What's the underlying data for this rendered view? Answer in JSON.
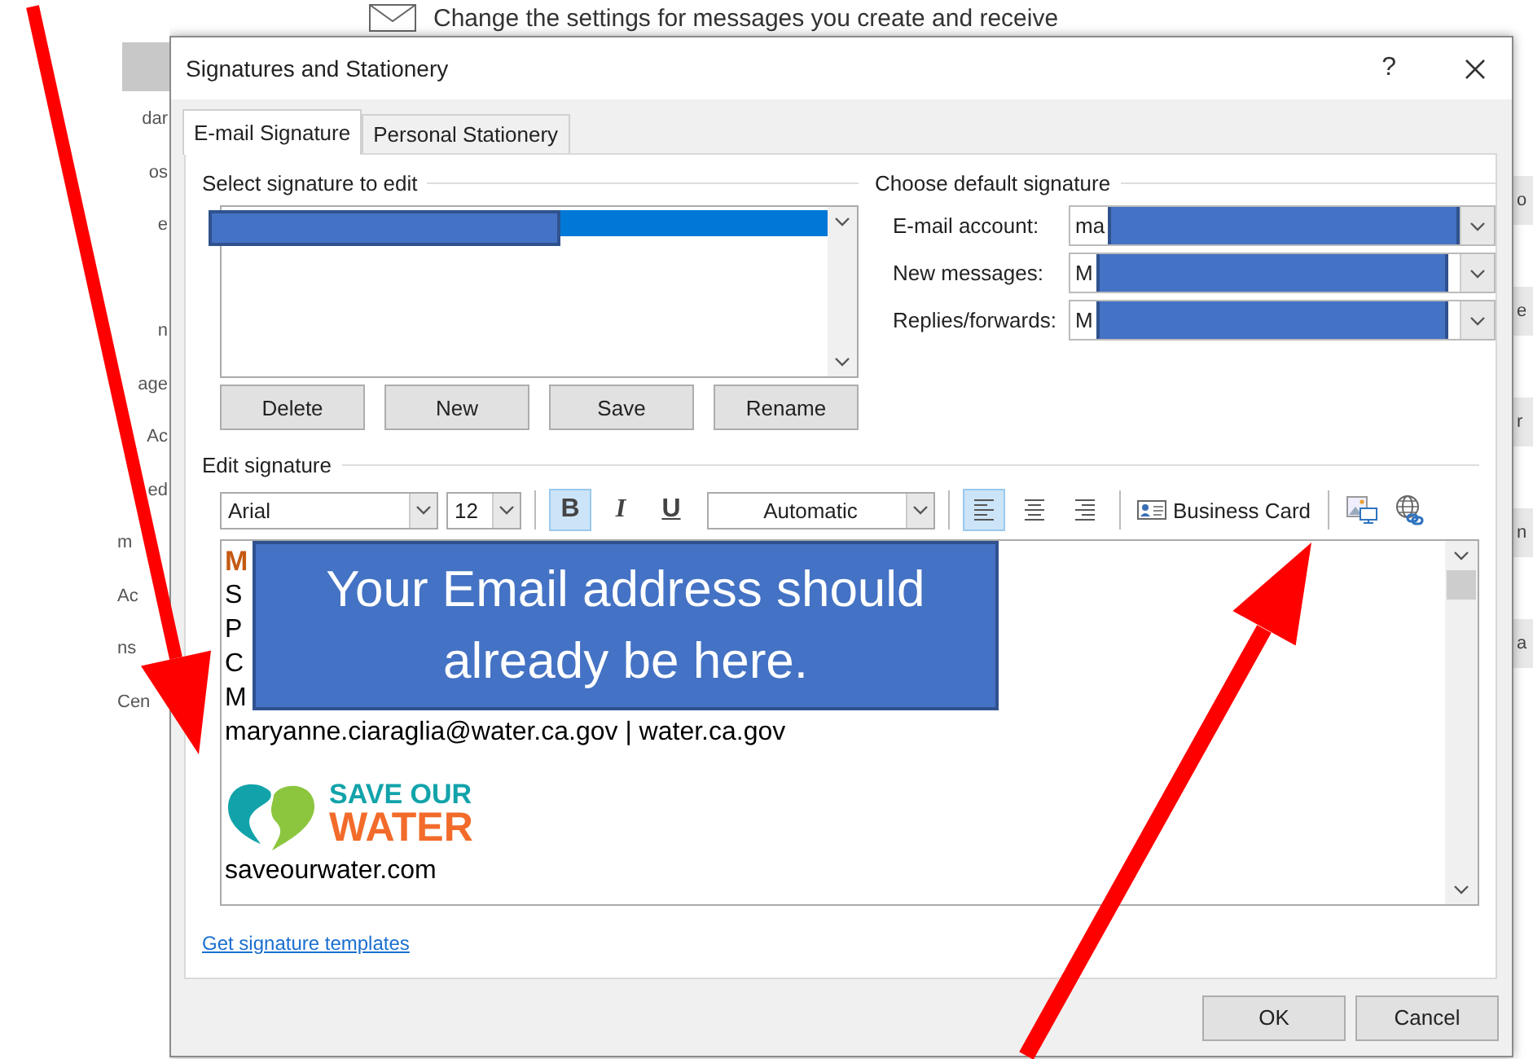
{
  "background": {
    "header_text": "Change the settings for messages you create and receive",
    "left_items": [
      "dar",
      "os",
      "e",
      "n",
      "age",
      "Ac",
      "ed",
      "m",
      "Ac",
      "ns",
      "Cen"
    ],
    "right_items": [
      "o",
      "e",
      "r",
      "n",
      "a"
    ]
  },
  "dialog": {
    "title": "Signatures and Stationery",
    "help": "?",
    "tabs": [
      {
        "label": "E-mail Signature",
        "selected": true
      },
      {
        "label": "Personal Stationery",
        "selected": false
      }
    ],
    "select_section": {
      "label": "Select signature to edit",
      "items": [
        {
          "selected": true
        }
      ],
      "buttons": [
        "Delete",
        "New",
        "Save",
        "Rename"
      ]
    },
    "default_section": {
      "label": "Choose default signature",
      "fields": [
        {
          "label": "E-mail account:",
          "value": "ma"
        },
        {
          "label": "New messages:",
          "value": "M"
        },
        {
          "label": "Replies/forwards:",
          "value": "M"
        }
      ]
    },
    "edit_section": {
      "label": "Edit signature",
      "toolbar": {
        "font": "Arial",
        "size": "12",
        "font_color": "Automatic",
        "business_card": "Business Card",
        "format_buttons": [
          {
            "kind": "bold",
            "label": "B",
            "selected": true
          },
          {
            "kind": "italic",
            "label": "I",
            "selected": false
          },
          {
            "kind": "underline",
            "label": "U",
            "selected": false
          }
        ],
        "align_buttons": [
          {
            "kind": "left",
            "selected": true
          },
          {
            "kind": "center",
            "selected": false
          },
          {
            "kind": "right",
            "selected": false
          }
        ]
      },
      "signature": {
        "lines": [
          {
            "text": "M",
            "kind": "name"
          },
          {
            "text": "S",
            "kind": "plain"
          },
          {
            "text": "P",
            "kind": "plain"
          },
          {
            "text": "C",
            "kind": "plain"
          },
          {
            "text": "M",
            "kind": "plain"
          },
          {
            "text": "maryanne.ciaraglia@water.ca.gov  |  water.ca.gov",
            "kind": "plain"
          }
        ],
        "logo": {
          "line1": "SAVE OUR",
          "line2": "WATER"
        },
        "website": "saveourwater.com"
      }
    },
    "link": "Get signature templates",
    "buttons": [
      "OK",
      "Cancel"
    ]
  },
  "annotation": {
    "callout": "Your Email address should already be here."
  }
}
